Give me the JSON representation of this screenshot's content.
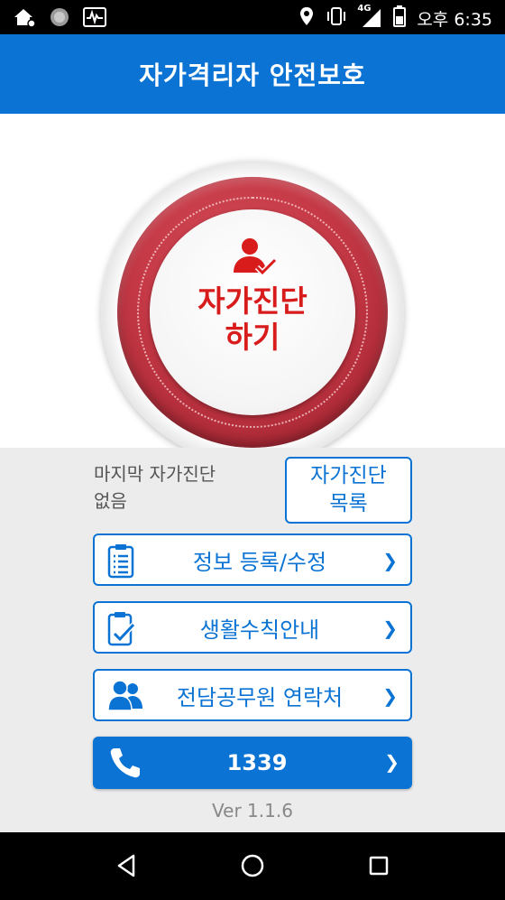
{
  "status_bar": {
    "network": "4G",
    "time": "오후 6:35"
  },
  "app_bar": {
    "title": "자가격리자 안전보호"
  },
  "hero": {
    "button_line1": "자가진단",
    "button_line2": "하기",
    "icon": "person-check-icon"
  },
  "last_diagnosis": {
    "line1": "마지막 자가진단",
    "line2": "없음"
  },
  "diagnosis_list_button": {
    "line1": "자가진단",
    "line2": "목록"
  },
  "menu": [
    {
      "label": "정보 등록/수정",
      "icon": "clipboard-icon"
    },
    {
      "label": "생활수칙안내",
      "icon": "clipboard-check-icon"
    },
    {
      "label": "전담공무원 연락처",
      "icon": "contacts-icon"
    }
  ],
  "call": {
    "number": "1339",
    "icon": "phone-icon"
  },
  "version": "Ver 1.1.6",
  "colors": {
    "primary": "#0a73d4",
    "hero_red": "#c43845",
    "label_red": "#d81b1b",
    "background_gray": "#ececec"
  }
}
